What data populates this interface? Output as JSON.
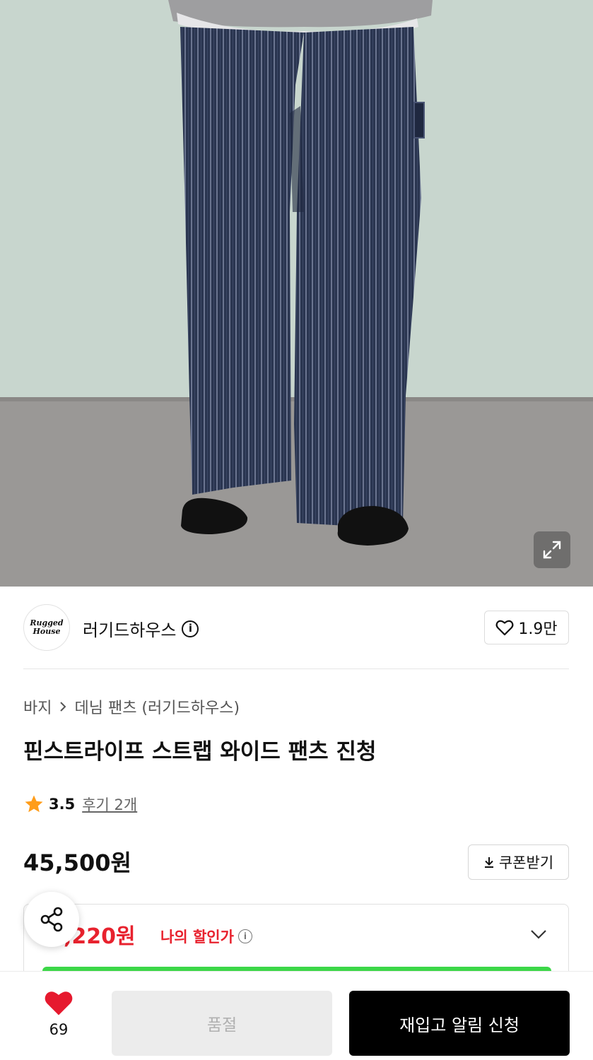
{
  "hero": {
    "image_alt": "pinstripe wide pants model photo",
    "expand_icon": "expand-icon"
  },
  "brand": {
    "logo_line1": "Rugged",
    "logo_line2": "House",
    "name": "러기드하우스",
    "info_icon": "info-icon",
    "like_count": "1.9만",
    "like_icon": "heart-outline-icon"
  },
  "breadcrumb": {
    "category": "바지",
    "separator_icon": "chevron-right-icon",
    "subcategory": "데님 팬츠 (러기드하우스)"
  },
  "product": {
    "title": "핀스트라이프 스트랩 와이드 팬츠 진청",
    "rating": "3.5",
    "rating_icon": "star-icon",
    "review_link": "후기 2개",
    "price": "45,500원",
    "coupon_label": "쿠폰받기",
    "coupon_icon": "download-icon"
  },
  "discount": {
    "price_partial": ",220원",
    "label": "나의 할인가",
    "toggle_icon": "chevron-down-icon"
  },
  "share": {
    "icon": "share-icon"
  },
  "bottom_bar": {
    "heart_icon": "heart-filled-icon",
    "heart_count": "69",
    "soldout_label": "품절",
    "notify_label": "재입고 알림 신청"
  },
  "colors": {
    "accent_red": "#e8222e",
    "heart_red": "#e6192e",
    "star_orange": "#ff9d1a",
    "green_bar": "#3cd748",
    "black": "#000000"
  }
}
